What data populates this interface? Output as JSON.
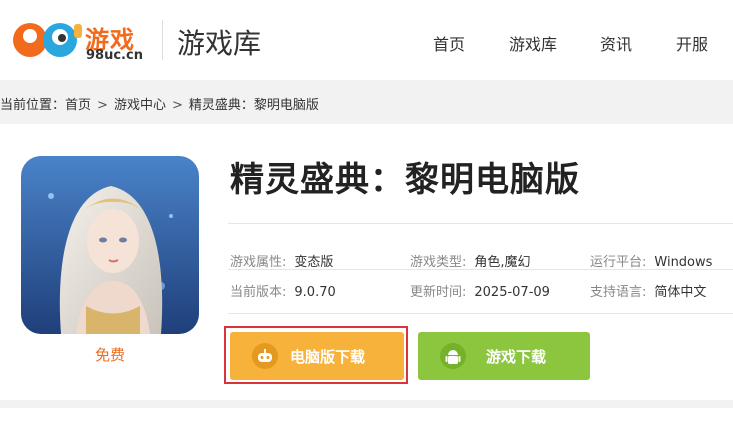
{
  "header": {
    "logo_text": "游戏",
    "logo_sub": "98uc.cn",
    "section_title": "游戏库",
    "nav": [
      "首页",
      "游戏库",
      "资讯",
      "开服"
    ]
  },
  "breadcrumb": {
    "prefix": "当前位置：",
    "items": [
      "首页",
      "游戏中心",
      "精灵盛典：黎明电脑版"
    ],
    "separator": ">"
  },
  "game": {
    "title": "精灵盛典：黎明电脑版",
    "price_label": "免费",
    "info": [
      {
        "key": "游戏属性:",
        "value": "变态版"
      },
      {
        "key": "游戏类型:",
        "value": "角色,魔幻"
      },
      {
        "key": "运行平台:",
        "value": "Windows"
      },
      {
        "key": "当前版本:",
        "value": "9.0.70"
      },
      {
        "key": "更新时间:",
        "value": "2025-07-09"
      },
      {
        "key": "支持语言:",
        "value": "简体中文"
      }
    ]
  },
  "buttons": {
    "pc_download": "电脑版下载",
    "mobile_download": "游戏下载"
  },
  "colors": {
    "brand_orange": "#f26b1d",
    "pc_button": "#f7b23b",
    "mobile_button": "#8cc63f",
    "highlight_border": "#d9343a"
  },
  "icons": {
    "logo": "98uc-logo-icon",
    "pc_button": "gamepad-icon",
    "mobile_button": "android-icon"
  }
}
